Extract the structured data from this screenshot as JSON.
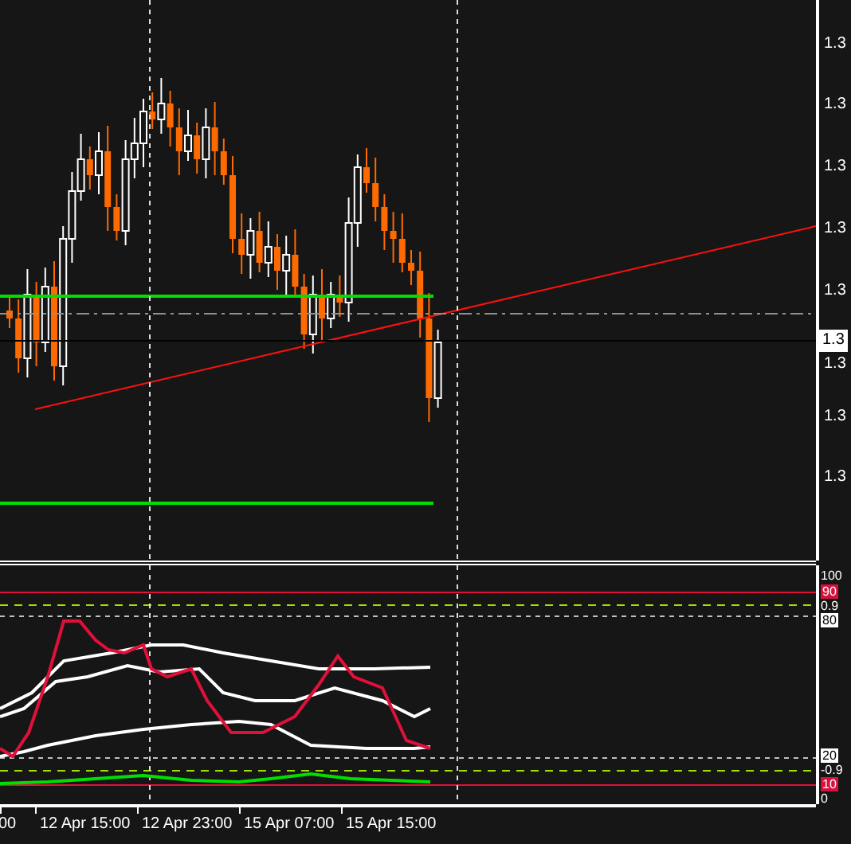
{
  "price_axis": {
    "labels": [
      "1.3",
      "1.3",
      "1.3",
      "1.3",
      "1.3",
      "1.3",
      "1.3",
      "1.3"
    ],
    "current_price": "1.3"
  },
  "indicator_axis": {
    "labels": [
      {
        "text": "100",
        "kind": "plain"
      },
      {
        "text": "90",
        "kind": "alarm"
      },
      {
        "text": "0.9",
        "kind": "plain"
      },
      {
        "text": "80",
        "kind": "tag"
      },
      {
        "text": "20",
        "kind": "tag"
      },
      {
        "text": "-0.9",
        "kind": "plain"
      },
      {
        "text": "10",
        "kind": "alarm"
      },
      {
        "text": "0",
        "kind": "plain"
      }
    ]
  },
  "time_axis": {
    "labels": [
      "00",
      "12 Apr 15:00",
      "12 Apr 23:00",
      "15 Apr 07:00",
      "15 Apr 15:00"
    ]
  }
}
